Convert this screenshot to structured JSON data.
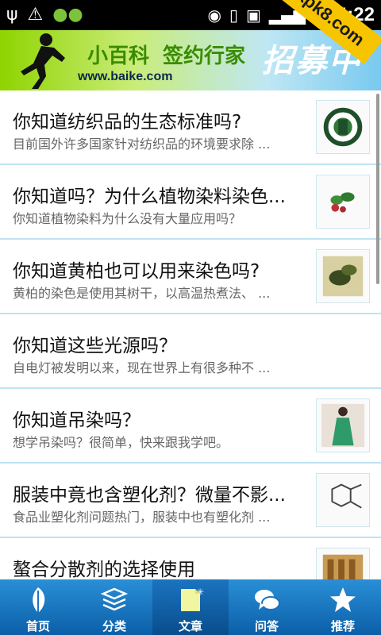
{
  "status_bar": {
    "time": "4:22"
  },
  "watermark": {
    "text": "apk8.com"
  },
  "banner": {
    "line1": "小百科",
    "line2": "签约行家",
    "big": "招募中",
    "url": "www.baike.com"
  },
  "articles": [
    {
      "title": "你知道纺织品的生态标准吗?",
      "summary": "目前国外许多国家针对纺织品的环境要求除 ..."
    },
    {
      "title": "你知道吗？为什么植物染料染色...",
      "summary": "你知道植物染料为什么没有大量应用吗？"
    },
    {
      "title": "你知道黄柏也可以用来染色吗?",
      "summary": "黄柏的染色是使用其树干，以高温热煮法、 ..."
    },
    {
      "title": "你知道这些光源吗？",
      "summary": "自电灯被发明以来，现在世界上有很多种不 ..."
    },
    {
      "title": "你知道吊染吗？",
      "summary": "想学吊染吗？很简单，快来跟我学吧。"
    },
    {
      "title": "服装中竟也含塑化剂？微量不影...",
      "summary": "食品业塑化剂问题热门，服装中也有塑化剂 ..."
    },
    {
      "title": "螯合分散剂的选择使用",
      "summary": ""
    }
  ],
  "tabs": [
    {
      "label": "首页",
      "icon": "leaf-icon"
    },
    {
      "label": "分类",
      "icon": "layers-icon"
    },
    {
      "label": "文章",
      "icon": "document-icon",
      "active": true
    },
    {
      "label": "问答",
      "icon": "chat-icon"
    },
    {
      "label": "推荐",
      "icon": "star-icon"
    }
  ],
  "colors": {
    "accent": "#1a74c2",
    "divider": "#bde4f4",
    "banner_green": "#8fd400"
  }
}
